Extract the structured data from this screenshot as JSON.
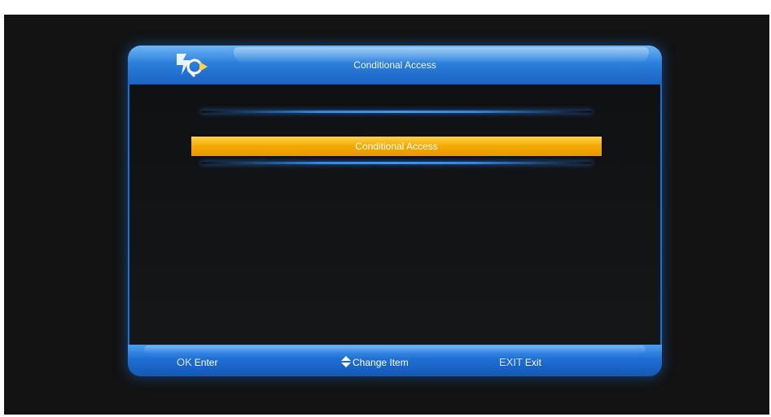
{
  "window": {
    "title": "Conditional Access"
  },
  "menu": {
    "items": [
      {
        "label": "Conditional Access",
        "selected": true
      }
    ]
  },
  "footer": {
    "ok_key": "OK",
    "ok_label": "Enter",
    "change_label": "Change Item",
    "exit_key": "EXIT",
    "exit_label": "Exit"
  },
  "colors": {
    "accent_blue": "#2c7fdc",
    "highlight_yellow": "#f4a900",
    "background": "#131313"
  },
  "icons": {
    "logo": "brand-logo-icon",
    "navigate": "up-down-arrows-icon"
  }
}
